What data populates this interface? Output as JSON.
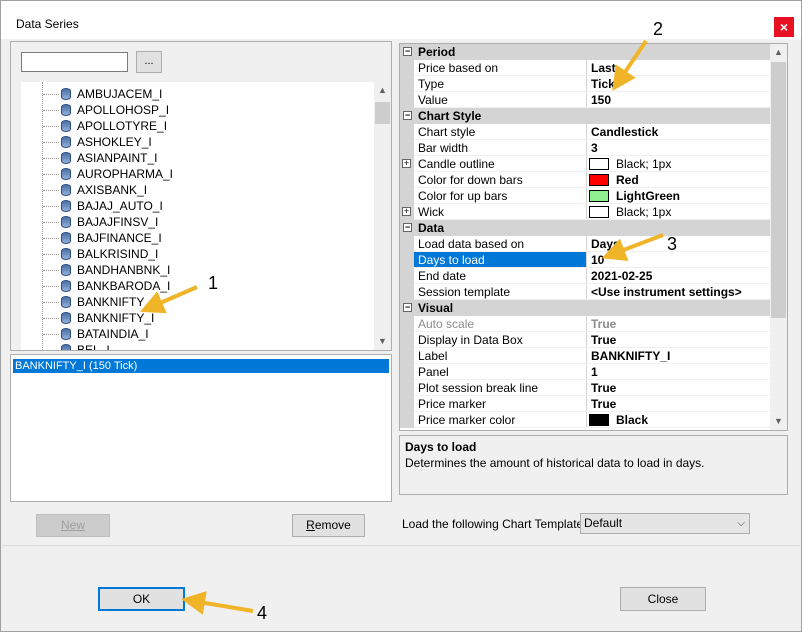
{
  "window": {
    "title": "Data Series",
    "close_icon": "close-icon"
  },
  "search": {
    "value": "",
    "browse_label": "..."
  },
  "tree": {
    "items": [
      "AMBUJACEM_I",
      "APOLLOHOSP_I",
      "APOLLOTYRE_I",
      "ASHOKLEY_I",
      "ASIANPAINT_I",
      "AUROPHARMA_I",
      "AXISBANK_I",
      "BAJAJ_AUTO_I",
      "BAJAJFINSV_I",
      "BAJFINANCE_I",
      "BALKRISIND_I",
      "BANDHANBNK_I",
      "BANKBARODA_I",
      "BANKNIFTY",
      "BANKNIFTY_I",
      "BATAINDIA_I",
      "BEL_I"
    ]
  },
  "series_list": {
    "items": [
      "BANKNIFTY_I (150 Tick)"
    ]
  },
  "buttons": {
    "new": "New",
    "remove_first": "R",
    "remove_rest": "emove",
    "ok": "OK",
    "close": "Close"
  },
  "grid": {
    "period": {
      "label": "Period",
      "rows": [
        {
          "name": "Price based on",
          "value": "Last"
        },
        {
          "name": "Type",
          "value": "Tick"
        },
        {
          "name": "Value",
          "value": "150"
        }
      ]
    },
    "chart_style": {
      "label": "Chart Style",
      "rows": [
        {
          "name": "Chart style",
          "value": "Candlestick"
        },
        {
          "name": "Bar width",
          "value": "3"
        },
        {
          "name": "Candle outline",
          "value": "Black; 1px",
          "swatch": "#ffffff"
        },
        {
          "name": "Color for down bars",
          "value": "Red",
          "swatch": "#ff0000"
        },
        {
          "name": "Color for up bars",
          "value": "LightGreen",
          "swatch": "#90ee90"
        },
        {
          "name": "Wick",
          "value": "Black; 1px",
          "swatch": "#ffffff"
        }
      ]
    },
    "data": {
      "label": "Data",
      "rows": [
        {
          "name": "Load data based on",
          "value": "Days"
        },
        {
          "name": "Days to load",
          "value": "10"
        },
        {
          "name": "End date",
          "value": "2021-02-25"
        },
        {
          "name": "Session template",
          "value": "<Use instrument settings>"
        }
      ]
    },
    "visual": {
      "label": "Visual",
      "rows": [
        {
          "name": "Auto scale",
          "value": "True"
        },
        {
          "name": "Display in Data Box",
          "value": "True"
        },
        {
          "name": "Label",
          "value": "BANKNIFTY_I"
        },
        {
          "name": "Panel",
          "value": "1"
        },
        {
          "name": "Plot session break line",
          "value": "True"
        },
        {
          "name": "Price marker",
          "value": "True"
        },
        {
          "name": "Price marker color",
          "value": "Black",
          "swatch": "#000000"
        }
      ]
    }
  },
  "description": {
    "title": "Days to load",
    "text": "Determines the amount of historical data to load in days."
  },
  "template": {
    "label": "Load the following Chart Template:",
    "selected": "Default"
  },
  "annotations": {
    "n1": "1",
    "n2": "2",
    "n3": "3",
    "n4": "4",
    "color": "#f0b429"
  },
  "colors": {
    "selection": "#0078d7",
    "category_bg": "#d4d4d4"
  }
}
